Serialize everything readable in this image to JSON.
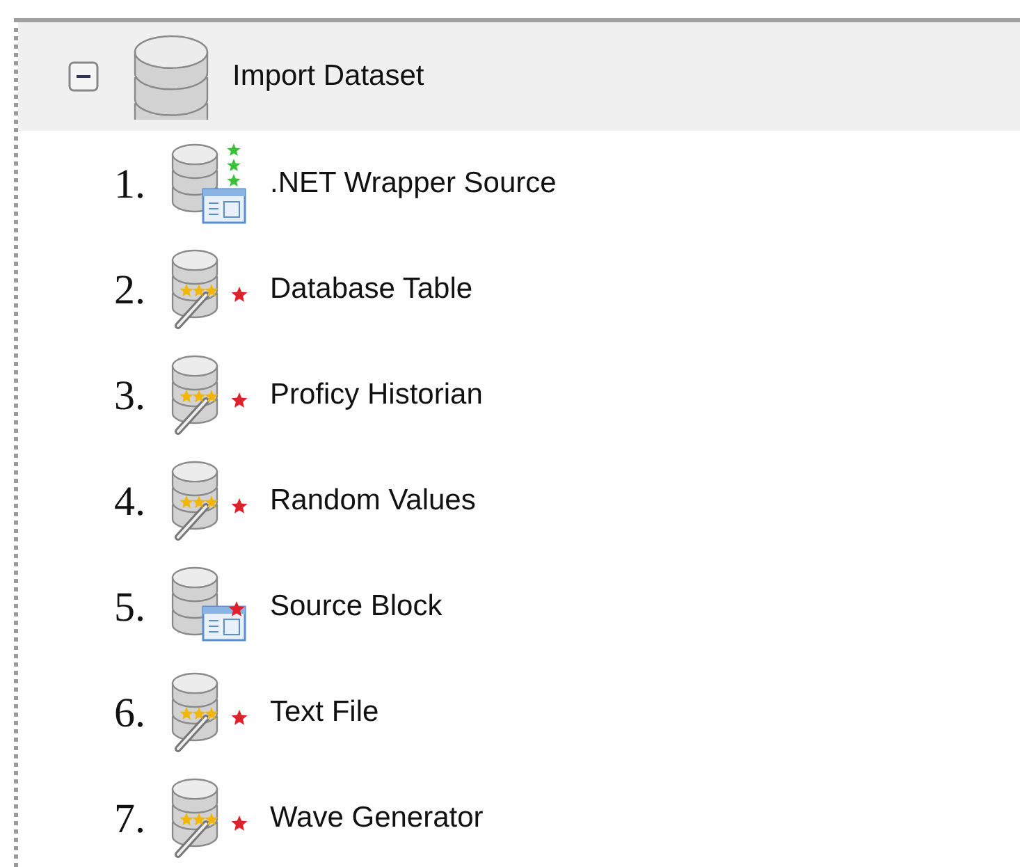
{
  "tree": {
    "label": "Import Dataset",
    "expanded": true,
    "children": [
      {
        "number": "1.",
        "label": ".NET Wrapper Source",
        "kind": "wrapper"
      },
      {
        "number": "2.",
        "label": "Database Table",
        "kind": "wand"
      },
      {
        "number": "3.",
        "label": "Proficy Historian",
        "kind": "wand"
      },
      {
        "number": "4.",
        "label": "Random Values",
        "kind": "wand"
      },
      {
        "number": "5.",
        "label": "Source Block",
        "kind": "block"
      },
      {
        "number": "6.",
        "label": "Text File",
        "kind": "wand"
      },
      {
        "number": "7.",
        "label": "Wave Generator",
        "kind": "wand"
      }
    ]
  }
}
